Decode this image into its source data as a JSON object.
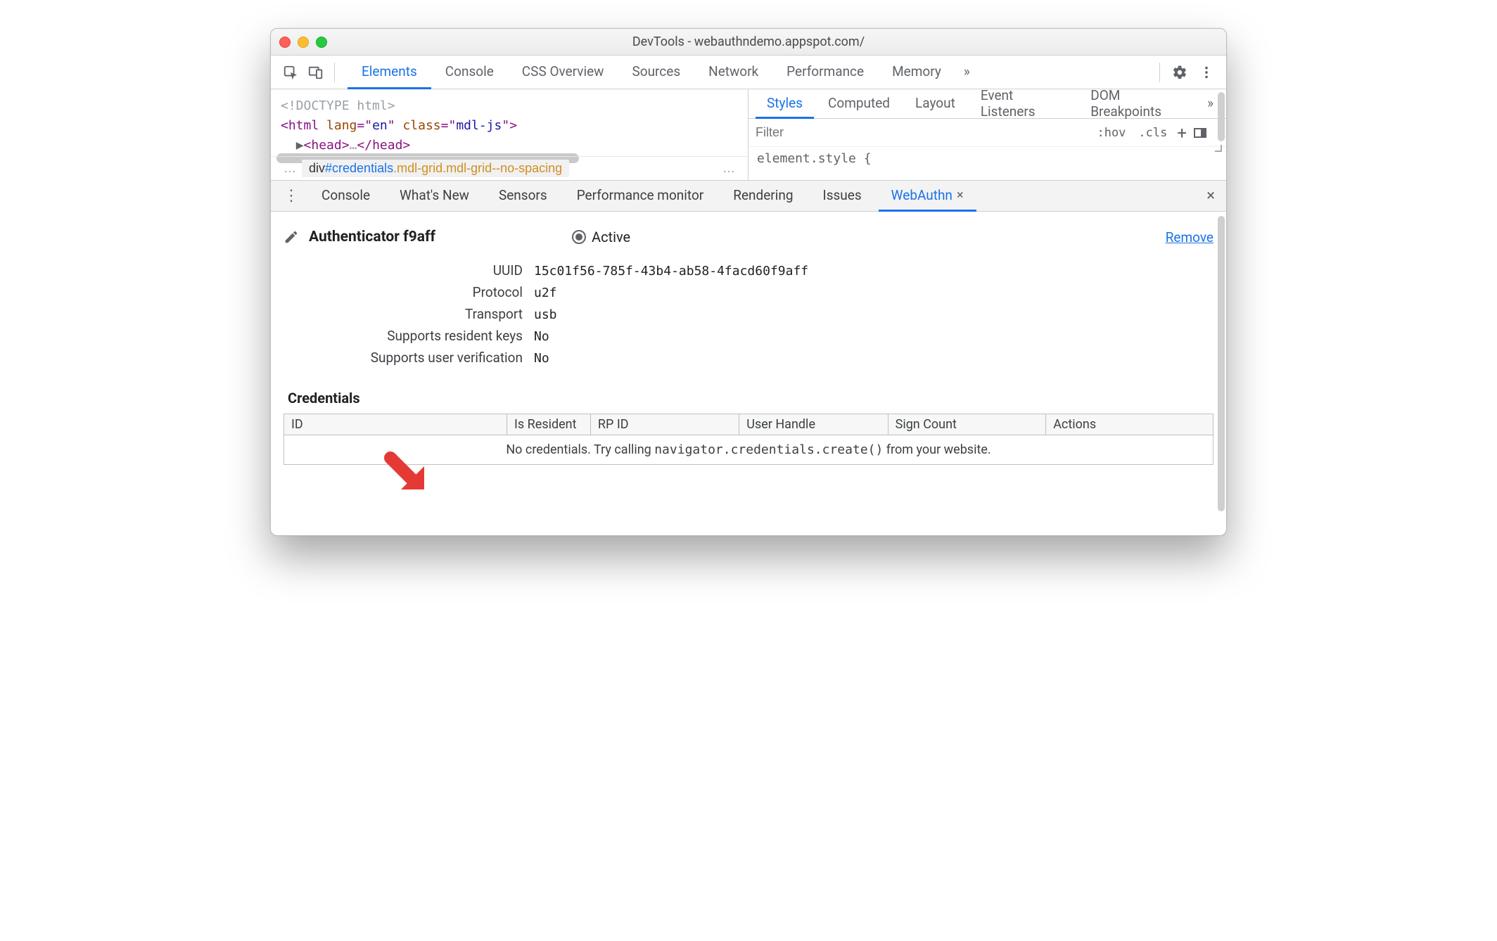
{
  "window": {
    "title": "DevTools - webauthndemo.appspot.com/"
  },
  "main_tabs": {
    "items": [
      "Elements",
      "Console",
      "CSS Overview",
      "Sources",
      "Network",
      "Performance",
      "Memory"
    ],
    "active": 0,
    "overflow": "»"
  },
  "dom": {
    "line0": "<!DOCTYPE html>",
    "line1": {
      "open": "<html ",
      "attr1": "lang",
      "eq": "=\"",
      "val1": "en",
      "q": "\" ",
      "attr2": "class",
      "eq2": "=\"",
      "val2": "mdl-js",
      "end": "\">"
    },
    "line2": {
      "arrow": "▶",
      "open": "<head>",
      "ell": "…",
      "close": "</head>"
    },
    "crumbs": {
      "ell_left": "…",
      "tag": "div",
      "id": "#credentials",
      "classes": ".mdl-grid.mdl-grid--no-spacing",
      "ell_right": "…"
    }
  },
  "styles_tabs": {
    "items": [
      "Styles",
      "Computed",
      "Layout",
      "Event Listeners",
      "DOM Breakpoints"
    ],
    "active": 0,
    "overflow": "»"
  },
  "styles_filter": {
    "placeholder": "Filter",
    "hov": ":hov",
    "cls": ".cls",
    "plus": "+"
  },
  "styles_rule": "element.style {",
  "drawer": {
    "items": [
      "Console",
      "What's New",
      "Sensors",
      "Performance monitor",
      "Rendering",
      "Issues",
      "WebAuthn"
    ],
    "active": 6
  },
  "webauthn": {
    "authenticator_name": "Authenticator f9aff",
    "active_label": "Active",
    "remove": "Remove",
    "props": {
      "uuid_label": "UUID",
      "uuid": "15c01f56-785f-43b4-ab58-4facd60f9aff",
      "protocol_label": "Protocol",
      "protocol": "u2f",
      "transport_label": "Transport",
      "transport": "usb",
      "srk_label": "Supports resident keys",
      "srk": "No",
      "suv_label": "Supports user verification",
      "suv": "No"
    },
    "credentials_title": "Credentials",
    "columns": [
      "ID",
      "Is Resident",
      "RP ID",
      "User Handle",
      "Sign Count",
      "Actions"
    ],
    "empty_prefix": "No credentials. Try calling ",
    "empty_code": "navigator.credentials.create()",
    "empty_suffix": " from your website."
  }
}
